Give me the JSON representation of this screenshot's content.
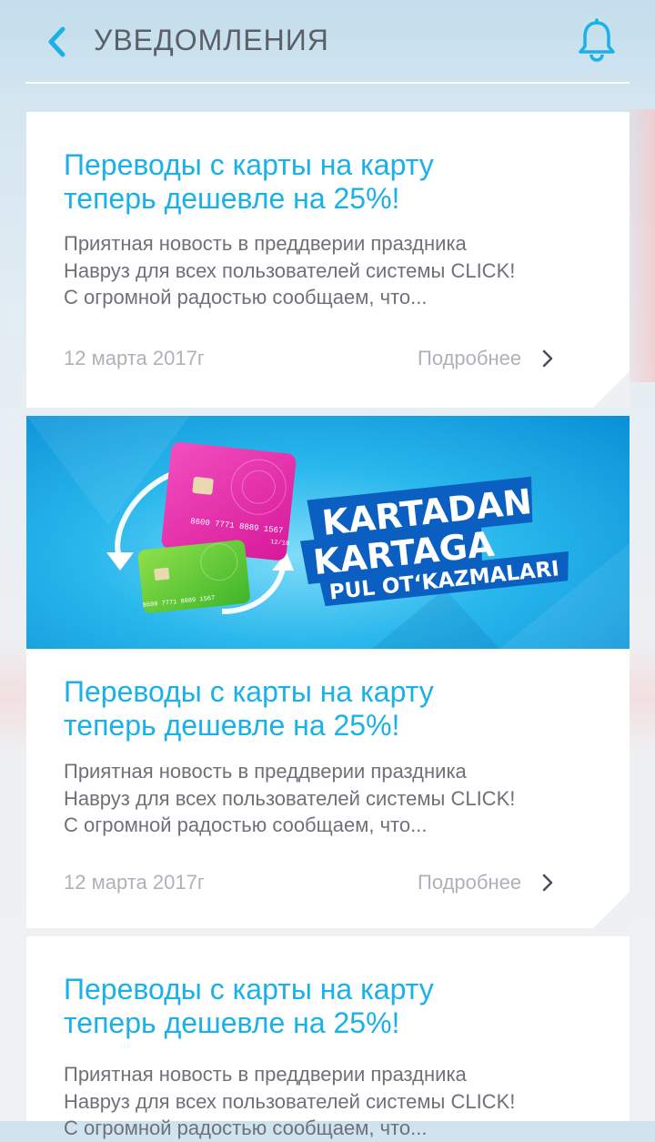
{
  "header": {
    "title": "УВЕДОМЛЕНИЯ",
    "back_icon": "chevron-left-icon",
    "bell_icon": "bell-icon",
    "accent": "#1ab0e8"
  },
  "notifications": [
    {
      "title_line1": "Переводы с карты на карту",
      "title_line2": "теперь дешевле на 25%!",
      "body_line1": "Приятная новость в преддверии праздника",
      "body_line2": "Навруз для всех пользователей системы CLICK!",
      "body_line3": "С огромной радостью сообщаем, что...",
      "date": "12 марта 2017г",
      "more": "Подробнее"
    },
    {
      "banner": {
        "line1": "KARTADAN",
        "line2": "KARTAGA",
        "line3": "PUL OT‘KAZMALARI",
        "card_number_pink": "8600 7771 8889 1567",
        "card_expiry_pink": "12/18",
        "card_number_green": "8600 7771 8889 1567"
      },
      "title_line1": "Переводы с карты на карту",
      "title_line2": "теперь дешевле на 25%!",
      "body_line1": "Приятная новость в преддверии праздника",
      "body_line2": "Навруз для всех пользователей системы CLICK!",
      "body_line3": "С огромной радостью сообщаем, что...",
      "date": "12 марта 2017г",
      "more": "Подробнее"
    },
    {
      "title_line1": "Переводы с карты на карту",
      "title_line2": "теперь дешевле на 25%!",
      "body_line1": "Приятная новость в преддверии праздника",
      "body_line2": "Навруз для всех пользователей системы CLICK!",
      "body_line3": "С огромной радостью сообщаем, что..."
    }
  ]
}
